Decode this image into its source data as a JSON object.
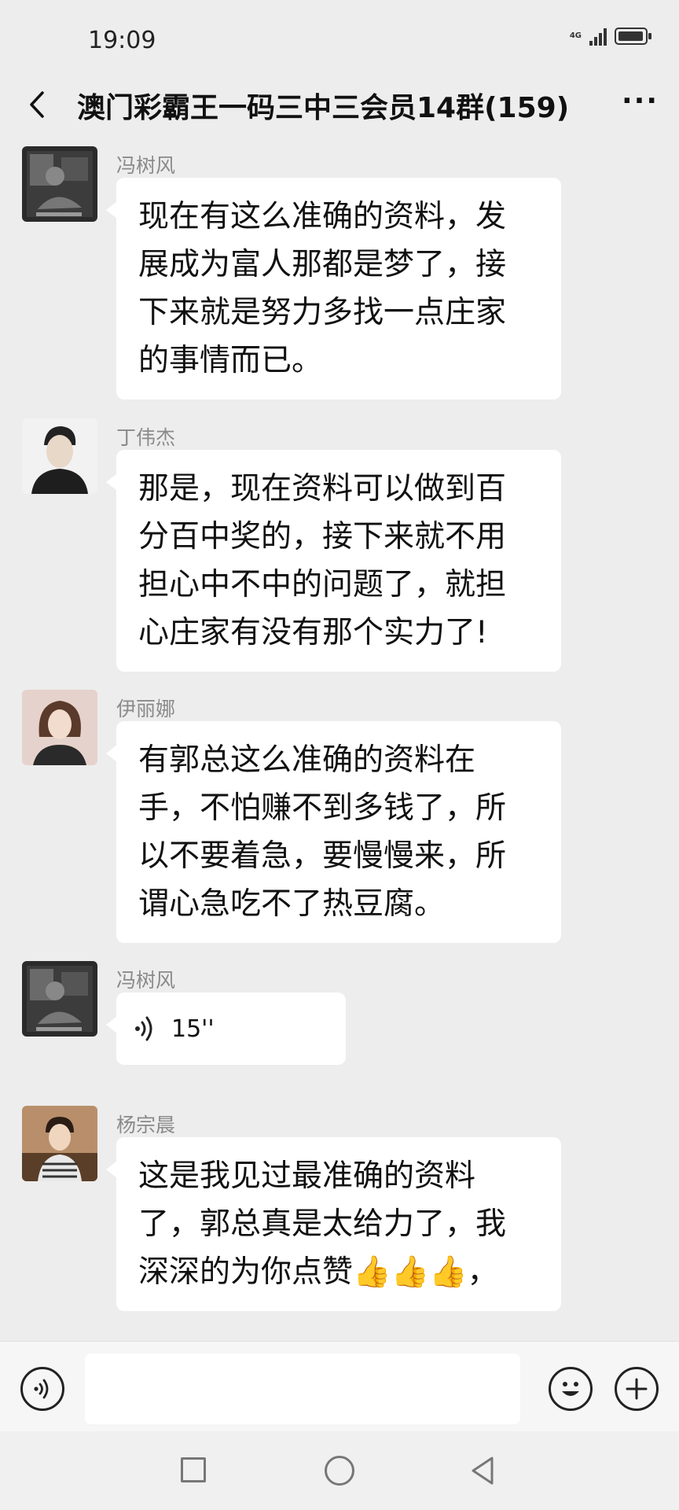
{
  "status": {
    "time": "19:09",
    "network": "4G"
  },
  "header": {
    "title": "澳门彩霸王一码三中三会员14群(159)",
    "more": "···"
  },
  "messages": [
    {
      "sender": "冯树风",
      "type": "text",
      "text": "现在有这么准确的资料，发\n展成为富人那都是梦了，接\n下来就是努力多找一点庄家\n的事情而已。"
    },
    {
      "sender": "丁伟杰",
      "type": "text",
      "text": "那是，现在资料可以做到百\n分百中奖的，接下来就不用\n担心中不中的问题了，就担\n心庄家有没有那个实力了!"
    },
    {
      "sender": "伊丽娜",
      "type": "text",
      "text": "有郭总这么准确的资料在\n手，不怕赚不到多钱了，所\n以不要着急，要慢慢来，所\n谓心急吃不了热豆腐。"
    },
    {
      "sender": "冯树风",
      "type": "voice",
      "text": "15''"
    },
    {
      "sender": "杨宗晨",
      "type": "text",
      "text": "这是我见过最准确的资料\n了，郭总真是太给力了，我\n深深的为你点赞👍👍👍，"
    }
  ],
  "icons": {
    "back": "chevron-left-icon",
    "voice_input": "voice-input-icon",
    "emoji": "emoji-icon",
    "add": "plus-icon"
  },
  "colors": {
    "background": "#ededed",
    "bubble": "#ffffff",
    "sender": "#8a8a8a"
  }
}
